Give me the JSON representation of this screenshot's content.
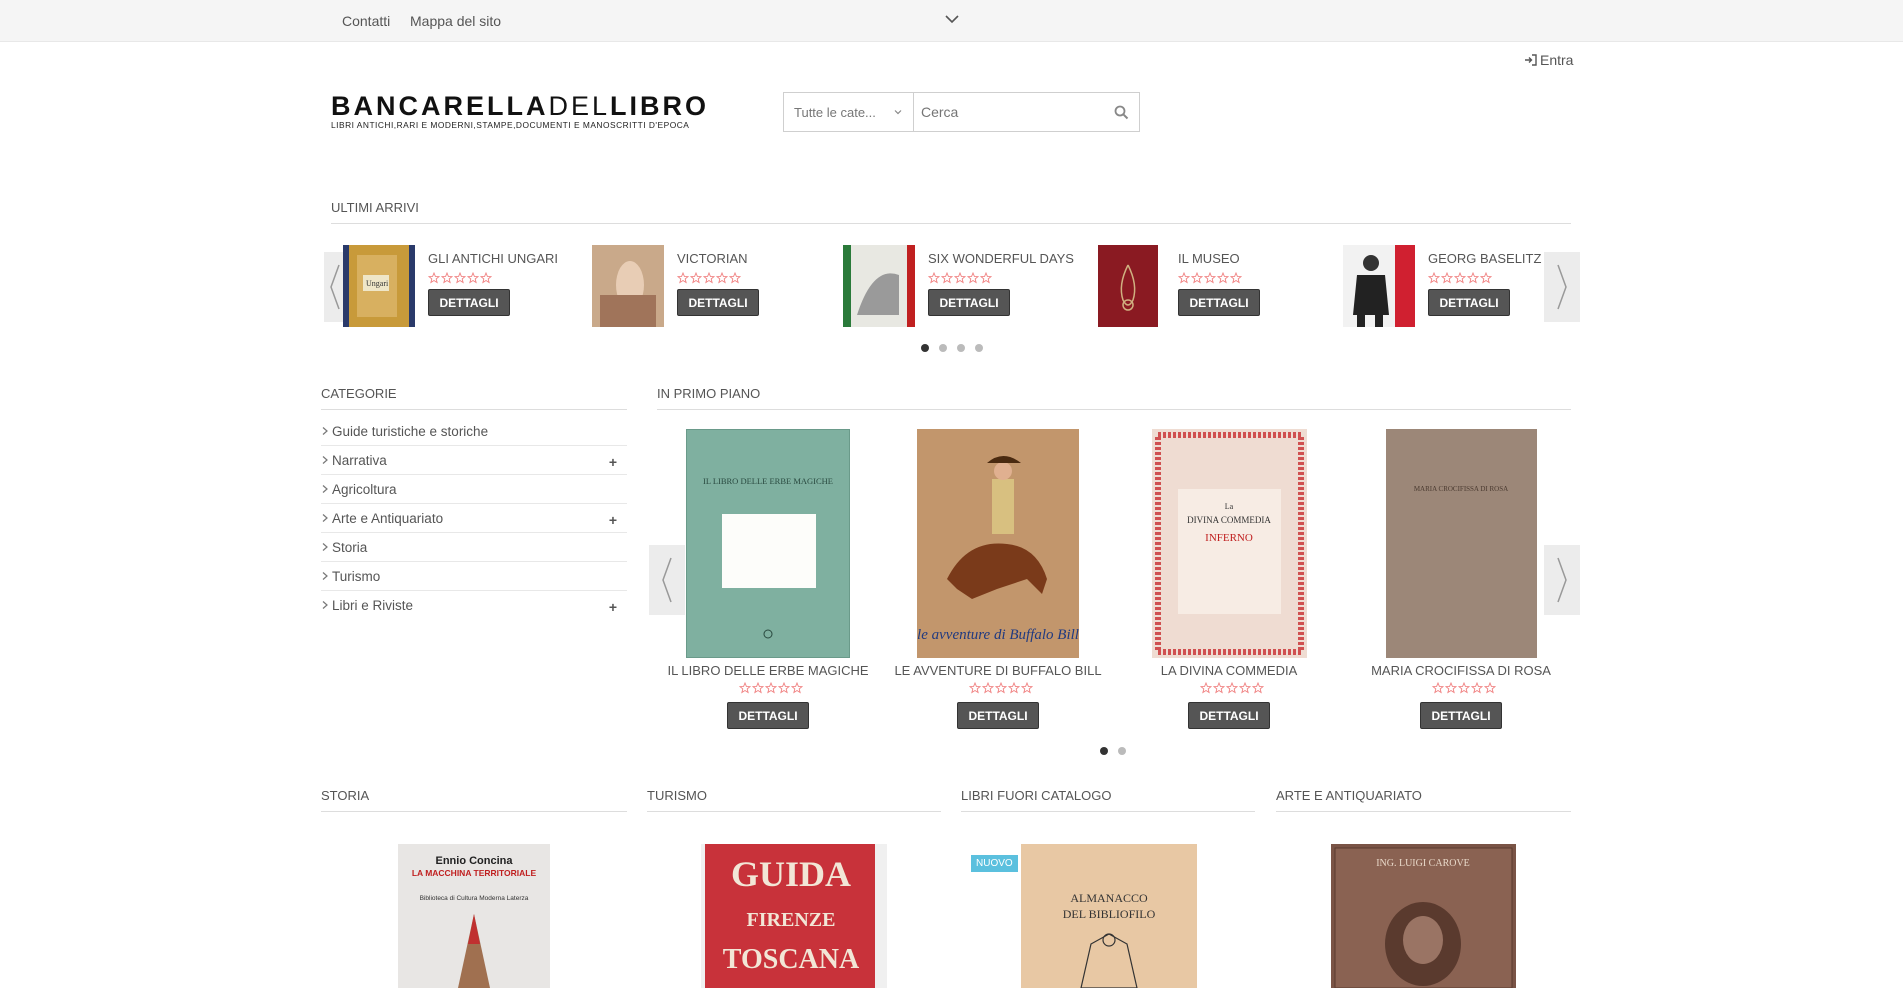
{
  "topbar": {
    "links": [
      "Contatti",
      "Mappa del sito"
    ]
  },
  "header": {
    "login_label": "Entra",
    "logo": {
      "part1": "BANCARELLA",
      "part2": "DEL",
      "part3": "LIBRO",
      "tagline": "LIBRI ANTICHI,RARI E MODERNI,STAMPE,DOCUMENTI E MANOSCRITTI D'EPOCA"
    },
    "search": {
      "category_selected": "Tutte le cate...",
      "placeholder": "Cerca"
    }
  },
  "ultimi_arrivi": {
    "title": "ULTIMI ARRIVI",
    "button_label": "DETTAGLI",
    "items": [
      {
        "name": "GLI ANTICHI UNGARI"
      },
      {
        "name": "VICTORIAN"
      },
      {
        "name": "SIX WONDERFUL DAYS"
      },
      {
        "name": "IL MUSEO"
      },
      {
        "name": "GEORG BASELITZ"
      }
    ],
    "pages": 4,
    "active_page": 1
  },
  "categorie": {
    "title": "CATEGORIE",
    "items": [
      {
        "label": "Guide turistiche e storiche",
        "expandable": false
      },
      {
        "label": "Narrativa",
        "expandable": true
      },
      {
        "label": "Agricoltura",
        "expandable": false
      },
      {
        "label": "Arte e Antiquariato",
        "expandable": true
      },
      {
        "label": "Storia",
        "expandable": false
      },
      {
        "label": "Turismo",
        "expandable": false
      },
      {
        "label": "Libri e Riviste",
        "expandable": true
      }
    ]
  },
  "in_primo_piano": {
    "title": "IN PRIMO PIANO",
    "button_label": "DETTAGLI",
    "items": [
      {
        "name": "IL LIBRO DELLE ERBE MAGICHE",
        "cover_text": "IL LIBRO DELLE ERBE MAGICHE"
      },
      {
        "name": "LE AVVENTURE DI BUFFALO BILL",
        "cover_text": "le avventure di Buffalo Bill"
      },
      {
        "name": "LA DIVINA COMMEDIA",
        "cover_text_1": "La",
        "cover_text_2": "DIVINA COMMEDIA",
        "cover_text_3": "INFERNO"
      },
      {
        "name": "MARIA CROCIFISSA DI ROSA",
        "cover_text": "MARIA CROCIFISSA DI ROSA"
      }
    ],
    "pages": 2,
    "active_page": 1
  },
  "bottom_sections": [
    {
      "title": "STORIA",
      "cover_author": "Ennio Concina",
      "cover_title": "LA MACCHINA TERRITORIALE",
      "cover_sub": "Biblioteca di Cultura Moderna Laterza"
    },
    {
      "title": "TURISMO",
      "cover_title": "GUIDA",
      "cover_sub": "FIRENZE",
      "cover_sub2": "TOSCANA"
    },
    {
      "title": "LIBRI FUORI CATALOGO",
      "badge": "NUOVO",
      "cover_title": "ALMANACCO",
      "cover_sub": "DEL BIBLIOFILO"
    },
    {
      "title": "ARTE E ANTIQUARIATO",
      "cover_title": "ING. LUIGI CAROVE"
    }
  ],
  "colors": {
    "button_bg": "#555555",
    "badge_new": "#5bc0de",
    "star_outline": "#f08080",
    "topbar_bg": "#f5f5f5"
  }
}
